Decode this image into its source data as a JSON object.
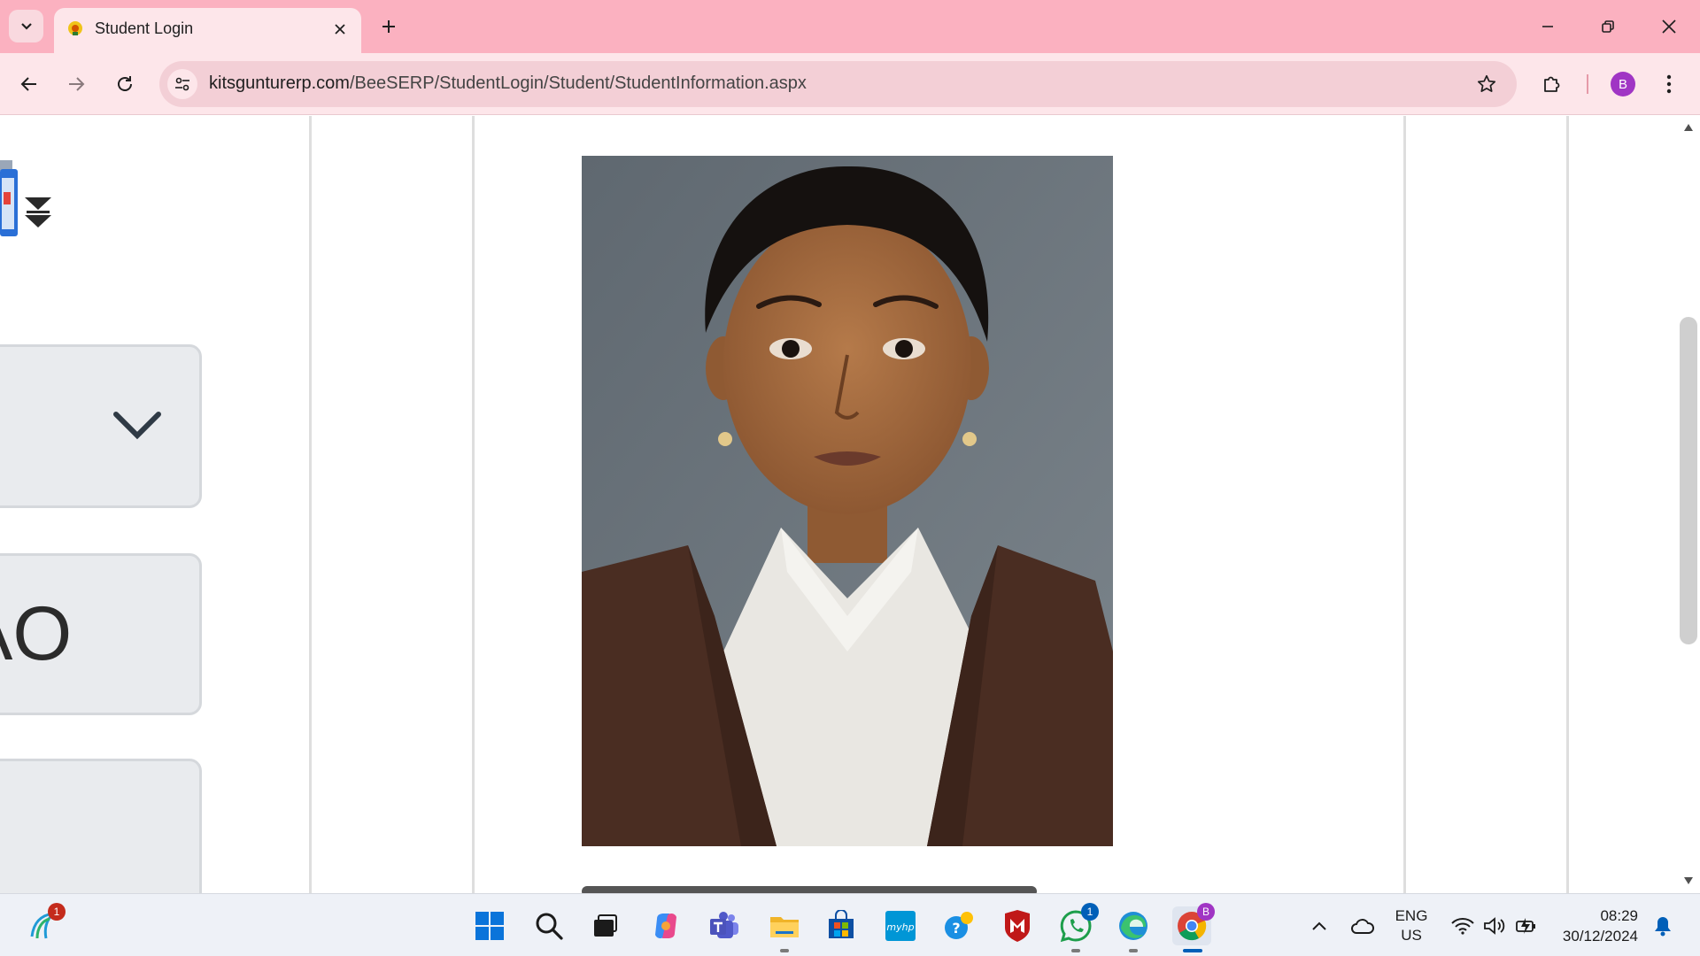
{
  "browser": {
    "tab_title": "Student Login",
    "url_domain": "kitsgunturerp.com",
    "url_path": "/BeeSERP/StudentLogin/Student/StudentInformation.aspx",
    "profile_initial": "B",
    "theme_color": "#fbb1c0"
  },
  "page": {
    "card_text": "AO"
  },
  "taskbar": {
    "widgets_badge": "1",
    "teams_badge": "",
    "whatsapp_badge": "1",
    "chrome_badge": "B",
    "lang_line1": "ENG",
    "lang_line2": "US",
    "time": "08:29",
    "date": "30/12/2024"
  }
}
